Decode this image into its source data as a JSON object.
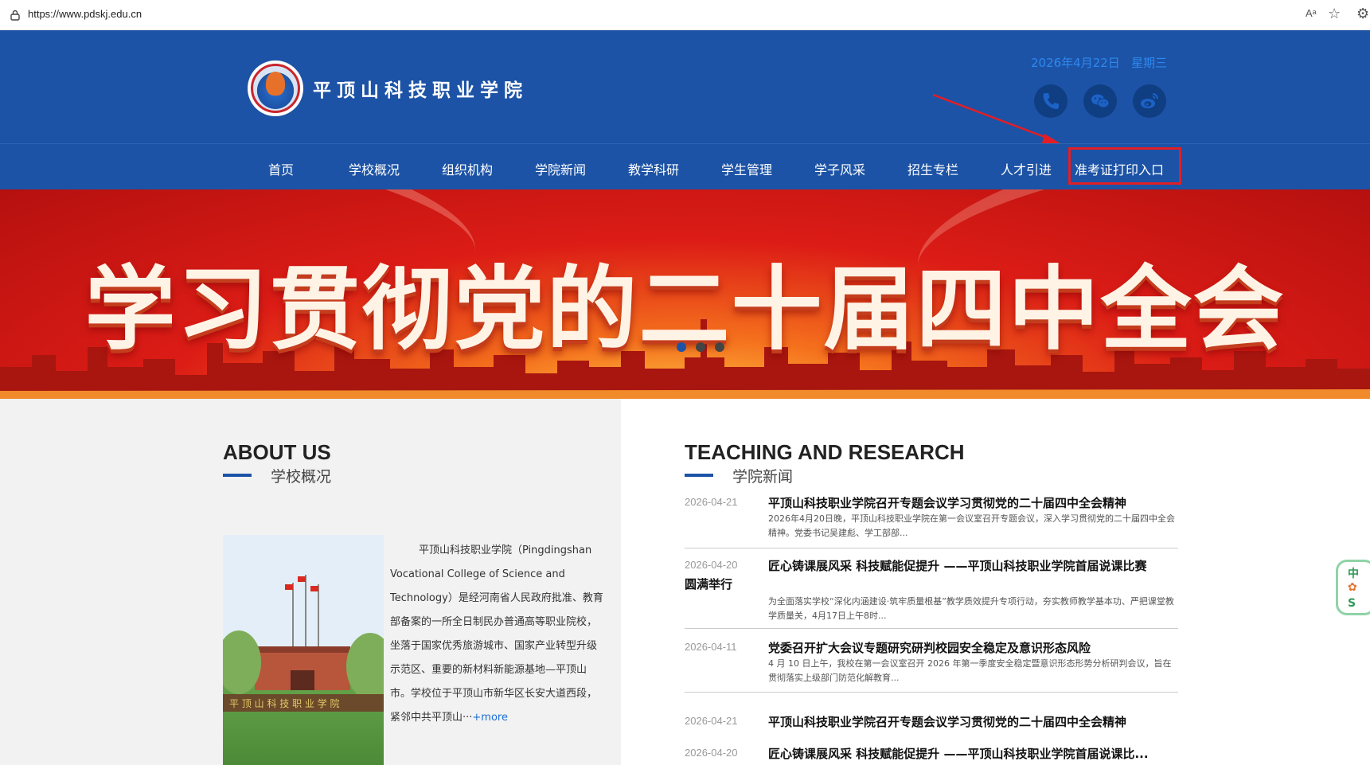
{
  "browser": {
    "url": "https://www.pdskj.edu.cn",
    "reader_label": "Aᵃ"
  },
  "header": {
    "school_name": "平顶山科技职业学院",
    "date": "2026年4月22日",
    "weekday": "星期三",
    "social": [
      "phone-icon",
      "wechat-icon",
      "weibo-icon"
    ]
  },
  "nav": {
    "items": [
      "首页",
      "学校概况",
      "组织机构",
      "学院新闻",
      "教学科研",
      "学生管理",
      "学子风采",
      "招生专栏",
      "人才引进",
      "准考证打印入口"
    ]
  },
  "banner": {
    "title": "学习贯彻党的二十届四中全会",
    "active_slide": 1,
    "slide_count": 3
  },
  "about": {
    "title_en": "ABOUT US",
    "title_cn": "学校概况",
    "text": "平顶山科技职业学院（Pingdingshan Vocational College of Science and Technology）是经河南省人民政府批准、教育部备案的一所全日制民办普通高等职业院校，坐落于国家优秀旅游城市、国家产业转型升级示范区、重要的新材料新能源基地—平顶山市。学校位于平顶山市新华区长安大道西段，紧邻中共平顶山···",
    "more": "+more"
  },
  "news": {
    "title_en": "TEACHING AND RESEARCH",
    "title_cn": "学院新闻",
    "items": [
      {
        "date": "2026-04-21",
        "title": "平顶山科技职业学院召开专题会议学习贯彻党的二十届四中全会精神",
        "summary": "2026年4月20日晚，平顶山科技职业学院在第一会议室召开专题会议，深入学习贯彻党的二十届四中全会精神。党委书记吴建彪、学工部部..."
      },
      {
        "date": "2026-04-20",
        "title": "匠心铸课展风采 科技赋能促提升 ——平顶山科技职业学院首届说课比赛",
        "title_cont": "圆满举行",
        "summary": "为全面落实学校“深化内涵建设·筑牢质量根基”教学质效提升专项行动，夯实教师教学基本功、严把课堂教学质量关，4月17日上午8时..."
      },
      {
        "date": "2026-04-11",
        "title": "党委召开扩大会议专题研究研判校园安全稳定及意识形态风险",
        "summary": "4 月 10 日上午，我校在第一会议室召开 2026 年第一季度安全稳定暨意识形态形势分析研判会议，旨在贯彻落实上级部门防范化解教育..."
      },
      {
        "date": "2026-04-21",
        "title": "平顶山科技职业学院召开专题会议学习贯彻党的二十届四中全会精神"
      },
      {
        "date": "2026-04-20",
        "title": "匠心铸课展风采 科技赋能促提升 ——平顶山科技职业学院首届说课比..."
      }
    ]
  },
  "float_tab": {
    "chars": [
      "中",
      "S"
    ]
  },
  "colors": {
    "primary": "#1c53a6",
    "highlight": "#e31e25",
    "banner": "#dc1c16"
  }
}
